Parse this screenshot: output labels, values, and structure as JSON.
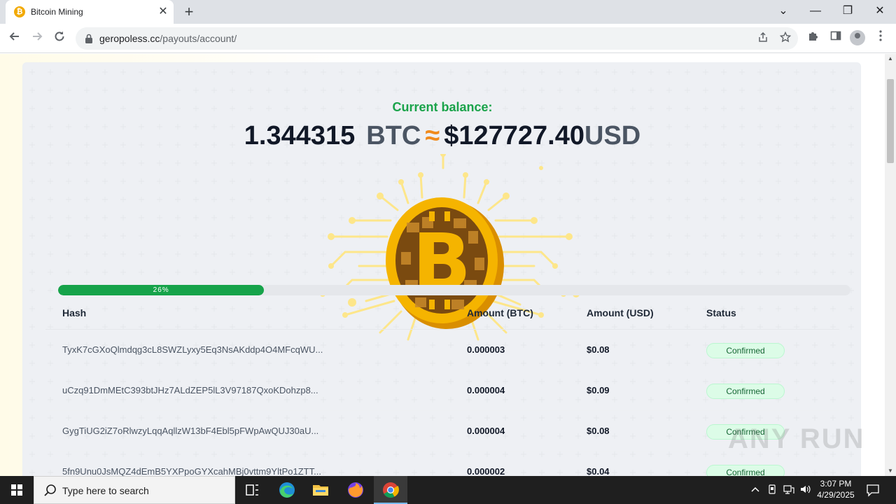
{
  "browser": {
    "tab_title": "Bitcoin Mining",
    "tab_favicon_glyph": "₿",
    "close_glyph": "✕",
    "new_tab_glyph": "+",
    "url_host": "geropoless.cc",
    "url_path": "/payouts/account/",
    "window_controls": {
      "dropdown": "⌄",
      "minimize": "—",
      "restore": "❐",
      "close": "✕"
    }
  },
  "page": {
    "balance_label": "Current balance:",
    "balance_btc": "1.344315",
    "balance_btc_unit": "BTC",
    "approx_symbol": "≈",
    "balance_usd": "$127727.40",
    "balance_usd_unit": "USD",
    "progress": {
      "percent": 26,
      "label": "26%"
    },
    "table": {
      "headers": {
        "hash": "Hash",
        "btc": "Amount (BTC)",
        "usd": "Amount (USD)",
        "status": "Status"
      },
      "rows": [
        {
          "hash": "TyxK7cGXoQlmdqg3cL8SWZLyxy5Eq3NsAKddp4O4MFcqWU...",
          "btc": "0.000003",
          "usd": "$0.08",
          "status": "Confirmed"
        },
        {
          "hash": "uCzq91DmMEtC393btJHz7ALdZEP5lL3V97187QxoKDohzp8...",
          "btc": "0.000004",
          "usd": "$0.09",
          "status": "Confirmed"
        },
        {
          "hash": "GygTiUG2iZ7oRlwzyLqqAqllzW13bF4Ebl5pFWpAwQUJ30aU...",
          "btc": "0.000004",
          "usd": "$0.08",
          "status": "Confirmed"
        },
        {
          "hash": "5fn9Unu0JsMQZ4dEmB5YXPpoGYXcahMBj0vttm9YltPo1ZTT...",
          "btc": "0.000002",
          "usd": "$0.04",
          "status": "Confirmed"
        }
      ]
    },
    "watermark": "ANY RUN"
  },
  "taskbar": {
    "search_placeholder": "Type here to search",
    "time": "3:07 PM",
    "date": "4/29/2025"
  },
  "colors": {
    "accent_green": "#16a34a",
    "label_green": "#1aa34a",
    "approx_orange": "#f08a1c",
    "coin_gold": "#f5b400"
  }
}
